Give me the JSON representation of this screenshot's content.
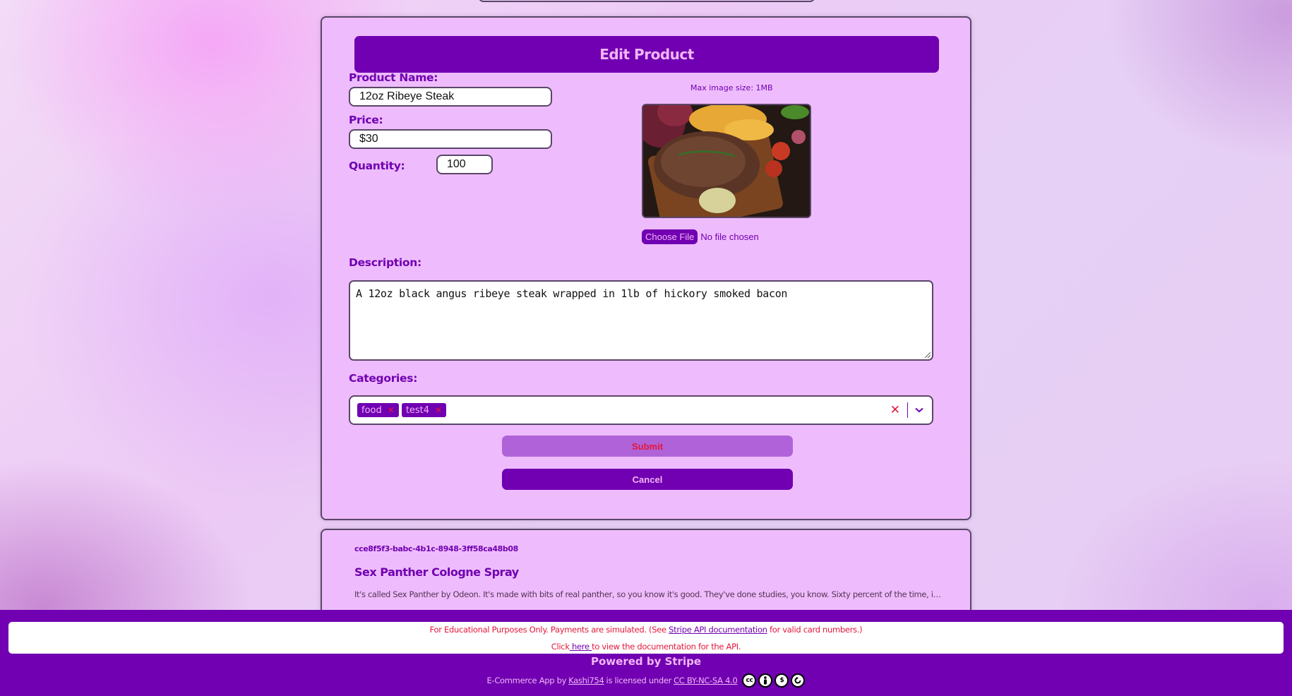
{
  "edit_form": {
    "title": "Edit Product",
    "product_name_label": "Product Name:",
    "product_name_value": "12oz Ribeye Steak",
    "price_label": "Price:",
    "price_value": "$30",
    "quantity_label": "Quantity:",
    "quantity_value": "100",
    "max_image_hint": "Max image size: 1MB",
    "choose_file_label": "Choose File",
    "file_status": "No file chosen",
    "description_label": "Description:",
    "description_value": "A 12oz black angus ribeye steak wrapped in 1lb of hickory smoked bacon",
    "categories_label": "Categories:",
    "categories": [
      {
        "label": "food"
      },
      {
        "label": "test4"
      }
    ],
    "submit_label": "Submit",
    "cancel_label": "Cancel"
  },
  "product_card": {
    "id": "cce8f5f3-babc-4b1c-8948-3ff58ca48b08",
    "name": "Sex Panther Cologne Spray",
    "description": "It's called Sex Panther by Odeon. It's made with bits of real panther, so you know it's good. They've done studies, you know. Sixty percent of the time, i…"
  },
  "footer": {
    "notice_prefix": "For Educational Purposes Only. Payments are simulated. (See ",
    "notice_link": "Stripe API documentation",
    "notice_suffix": " for valid card numbers.)",
    "click_prefix": "Click",
    "click_link": " here ",
    "click_suffix": "to view the documentation for the API.",
    "powered_by": "Powered by Stripe",
    "license_prefix": "E-Commerce App by",
    "author_link": " Kashi754",
    "license_mid": "is licensed under",
    "license_link": "CC BY-NC-SA 4.0",
    "license_icons": [
      "cc-icon",
      "by-icon",
      "nc-icon",
      "sa-icon"
    ]
  },
  "colors": {
    "brand_purple": "#7000b1",
    "card_bg": "#eebcfc",
    "accent_pink": "#f2b5f7",
    "danger_red": "#e3173d",
    "submit_bg": "#b063d8"
  }
}
